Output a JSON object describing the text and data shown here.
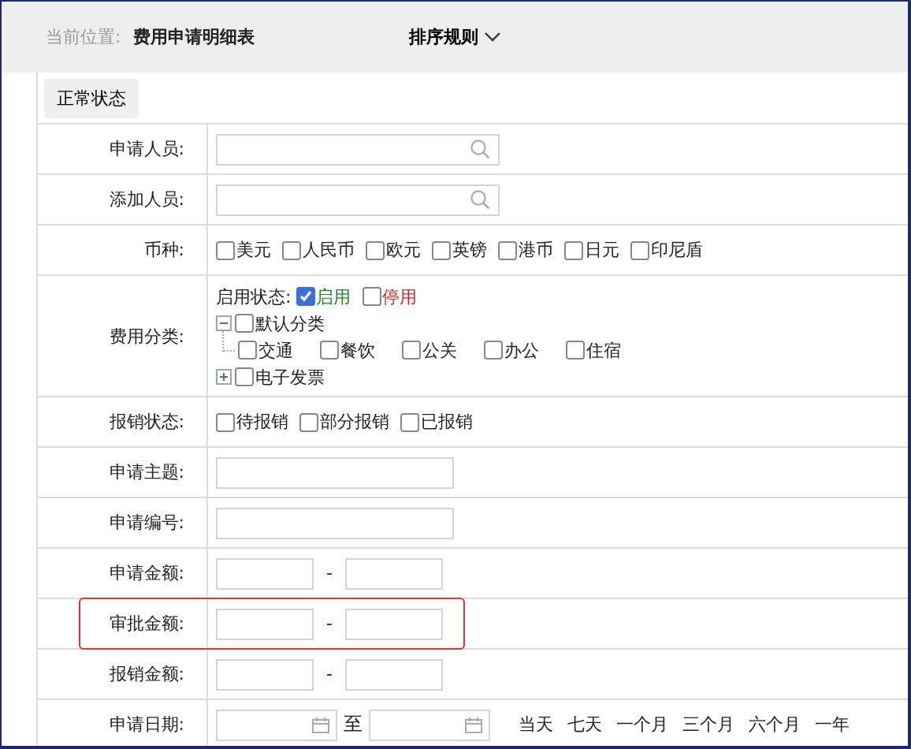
{
  "header": {
    "location_label": "当前位置:",
    "location": "费用申请明细表",
    "sort_label": "排序规则"
  },
  "status_button": "正常状态",
  "rows": [
    {
      "kind": "search",
      "label": "申请人员:",
      "highlighted": false
    },
    {
      "kind": "search",
      "label": "添加人员:",
      "highlighted": false
    },
    {
      "kind": "checks",
      "label": "币种:",
      "highlighted": false,
      "options": [
        {
          "label": "美元",
          "checked": false
        },
        {
          "label": "人民币",
          "checked": false
        },
        {
          "label": "欧元",
          "checked": false
        },
        {
          "label": "英镑",
          "checked": false
        },
        {
          "label": "港币",
          "checked": false
        },
        {
          "label": "日元",
          "checked": false
        },
        {
          "label": "印尼盾",
          "checked": false
        }
      ]
    },
    {
      "kind": "category",
      "label": "费用分类:",
      "highlighted": false,
      "status_label": "启用状态:",
      "status_options": [
        {
          "label": "启用",
          "checked": true,
          "color": "#1a8a1a"
        },
        {
          "label": "停用",
          "checked": false,
          "color": "#e02020"
        }
      ],
      "tree": [
        {
          "label": "默认分类",
          "checked": false,
          "expanded": true,
          "children": [
            {
              "label": "交通",
              "checked": false
            },
            {
              "label": "餐饮",
              "checked": false
            },
            {
              "label": "公关",
              "checked": false
            },
            {
              "label": "办公",
              "checked": false
            },
            {
              "label": "住宿",
              "checked": false
            }
          ]
        },
        {
          "label": "电子发票",
          "checked": false,
          "expanded": false
        }
      ]
    },
    {
      "kind": "checks",
      "label": "报销状态:",
      "highlighted": false,
      "options": [
        {
          "label": "待报销",
          "checked": false
        },
        {
          "label": "部分报销",
          "checked": false
        },
        {
          "label": "已报销",
          "checked": false
        }
      ]
    },
    {
      "kind": "text",
      "label": "申请主题:",
      "highlighted": false
    },
    {
      "kind": "text",
      "label": "申请编号:",
      "highlighted": false
    },
    {
      "kind": "range",
      "label": "申请金额:",
      "highlighted": false,
      "separator": "-"
    },
    {
      "kind": "range",
      "label": "审批金额:",
      "highlighted": true,
      "separator": "-"
    },
    {
      "kind": "range",
      "label": "报销金额:",
      "highlighted": false,
      "separator": "-"
    },
    {
      "kind": "daterange",
      "label": "申请日期:",
      "highlighted": false,
      "separator": "至",
      "quick": [
        "当天",
        "七天",
        "一个月",
        "三个月",
        "六个月",
        "一年"
      ]
    }
  ]
}
